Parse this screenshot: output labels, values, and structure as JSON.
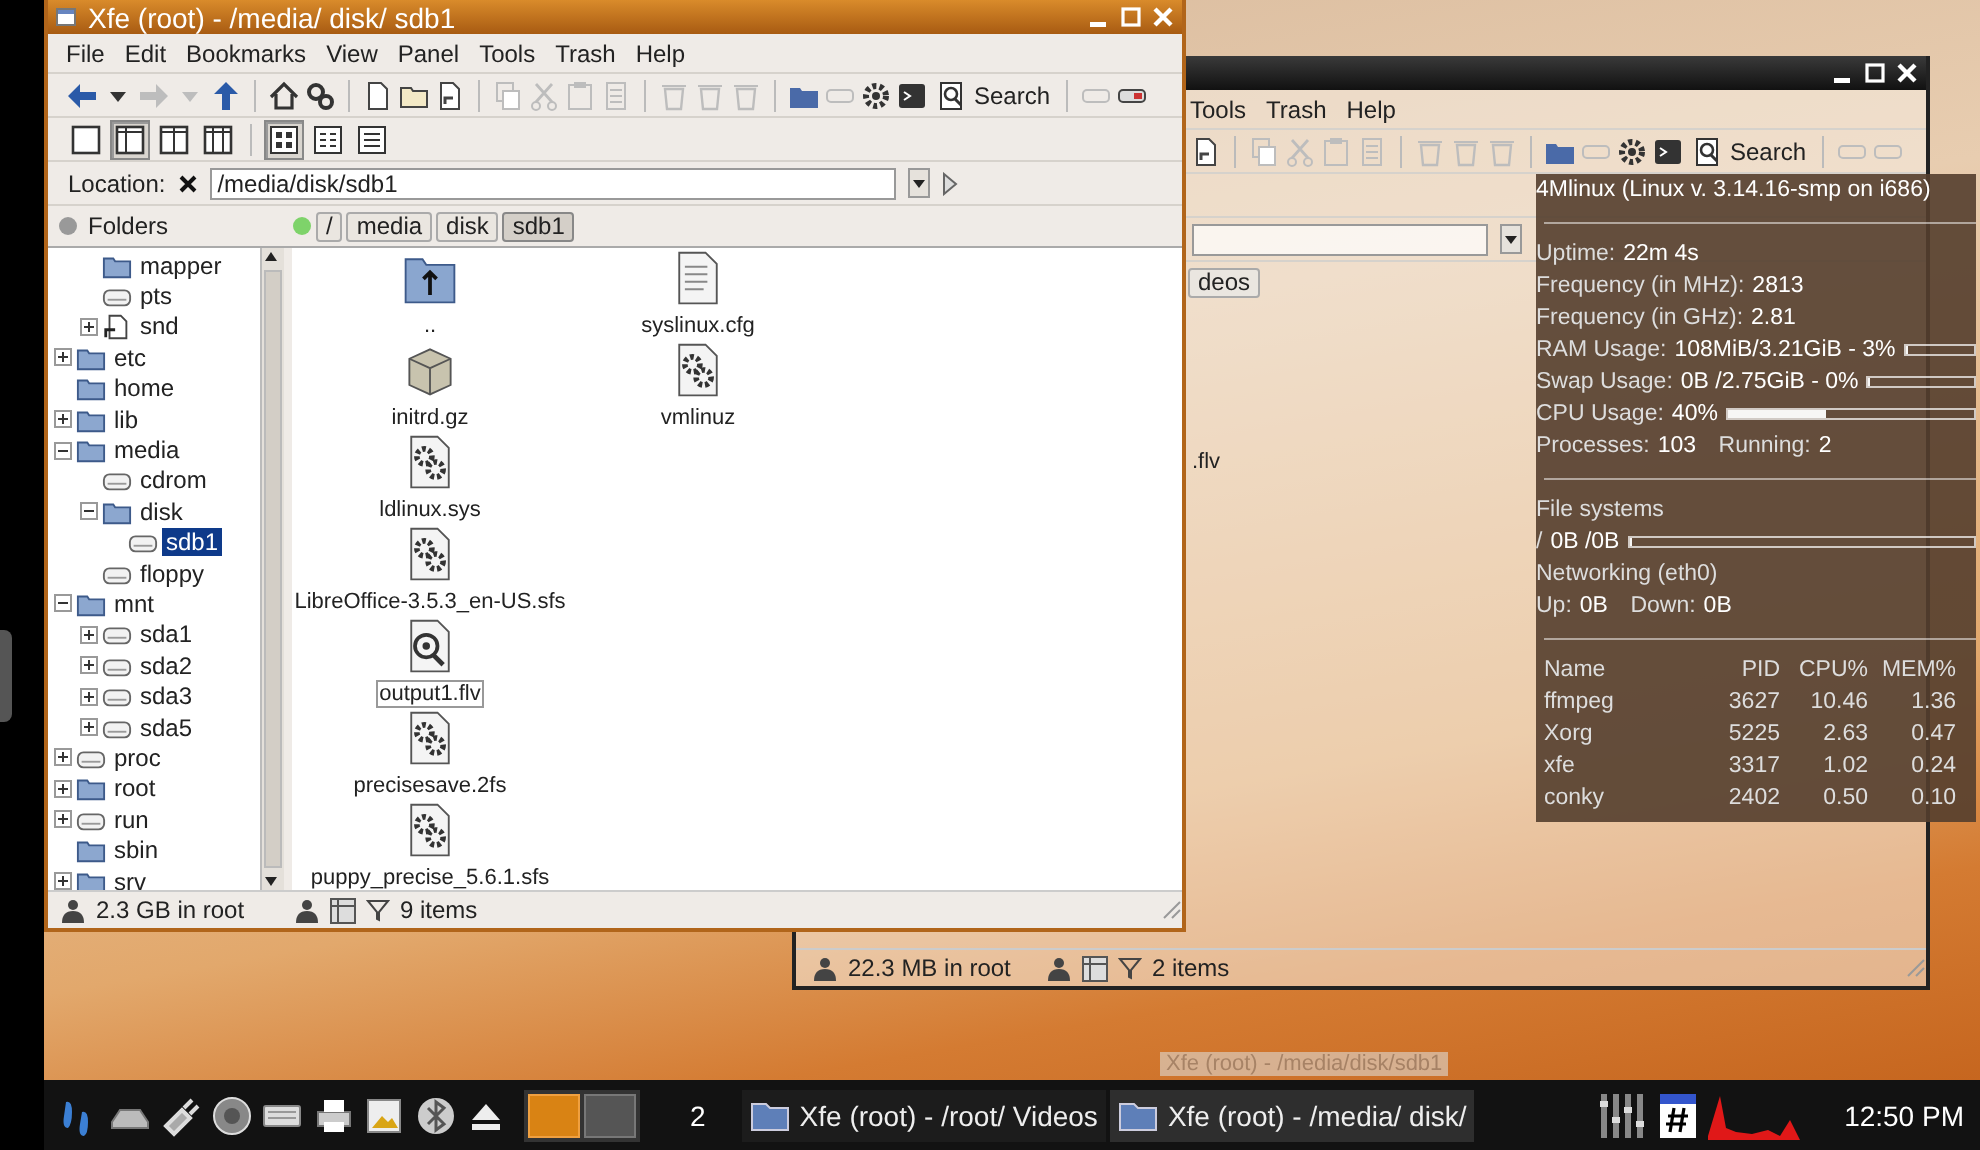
{
  "back_window": {
    "menu": [
      "Tools",
      "Trash",
      "Help"
    ],
    "toolbar": [
      {
        "kind": "link",
        "disabled": false
      },
      {
        "kind": "separator"
      },
      {
        "kind": "copy",
        "disabled": true
      },
      {
        "kind": "cut",
        "disabled": true
      },
      {
        "kind": "paste",
        "disabled": true
      },
      {
        "kind": "props",
        "disabled": true
      },
      {
        "kind": "separator"
      },
      {
        "kind": "trash",
        "disabled": true
      },
      {
        "kind": "trash",
        "disabled": true
      },
      {
        "kind": "trash",
        "disabled": true
      },
      {
        "kind": "separator"
      },
      {
        "kind": "dirs",
        "disabled": false
      },
      {
        "kind": "dirs2",
        "disabled": true
      },
      {
        "kind": "gears",
        "disabled": false
      },
      {
        "kind": "terminal",
        "disabled": false
      },
      {
        "kind": "search",
        "label": "Search",
        "disabled": false
      },
      {
        "kind": "separator"
      },
      {
        "kind": "panel",
        "disabled": true
      },
      {
        "kind": "panel",
        "disabled": true
      }
    ],
    "breadcrumb": [
      {
        "label": "deos",
        "selected": false
      }
    ],
    "files": [
      ".flv"
    ],
    "status": {
      "disk": "22.3 MB in root",
      "items": "2 items"
    }
  },
  "conky": {
    "lines": [
      {
        "kind": "title",
        "text": "4Mlinux (Linux v. 3.14.16-smp on i686)"
      },
      {
        "kind": "rule"
      },
      {
        "kind": "pair",
        "label": "Uptime:",
        "value": "22m 4s"
      },
      {
        "kind": "pair",
        "label": "Frequency (in MHz):",
        "value": "2813"
      },
      {
        "kind": "pair",
        "label": "Frequency (in GHz):",
        "value": "2.81"
      },
      {
        "kind": "bar",
        "label": "RAM Usage:",
        "value": "108MiB/3.21GiB - 3%",
        "level": 0.03
      },
      {
        "kind": "bar",
        "label": "Swap Usage:",
        "value": "0B /2.75GiB - 0%",
        "level": 0
      },
      {
        "kind": "bar",
        "label": "CPU Usage:",
        "value": "40%",
        "level": 0.4
      },
      {
        "kind": "pair",
        "label": "Processes:",
        "value": "103",
        "label2": "Running:",
        "value2": "2"
      },
      {
        "kind": "rule"
      },
      {
        "kind": "heading",
        "text": "File systems"
      },
      {
        "kind": "bar",
        "label": "/",
        "value": "0B /0B",
        "level": 0
      },
      {
        "kind": "heading",
        "text": "Networking (eth0)"
      },
      {
        "kind": "pair",
        "label": "Up:",
        "value": "0B",
        "label2": "Down:",
        "value2": "0B"
      },
      {
        "kind": "rule"
      }
    ],
    "table": {
      "columns": [
        "Name",
        "PID",
        "CPU%",
        "MEM%"
      ],
      "rows": [
        [
          "ffmpeg",
          "3627",
          "10.46",
          "1.36"
        ],
        [
          "Xorg",
          "5225",
          "2.63",
          "0.47"
        ],
        [
          "xfe",
          "3317",
          "1.02",
          "0.24"
        ],
        [
          "conky",
          "2402",
          "0.50",
          "0.10"
        ]
      ]
    }
  },
  "front_window": {
    "title": "Xfe (root) - /media/ disk/ sdb1",
    "menu": [
      "File",
      "Edit",
      "Bookmarks",
      "View",
      "Panel",
      "Tools",
      "Trash",
      "Help"
    ],
    "toolbar": [
      {
        "kind": "back",
        "disabled": false
      },
      {
        "kind": "caret",
        "disabled": false
      },
      {
        "kind": "forward",
        "disabled": true
      },
      {
        "kind": "caret",
        "disabled": true
      },
      {
        "kind": "up",
        "disabled": false
      },
      {
        "kind": "separator"
      },
      {
        "kind": "home",
        "disabled": false
      },
      {
        "kind": "refresh",
        "disabled": false
      },
      {
        "kind": "separator"
      },
      {
        "kind": "file",
        "disabled": false
      },
      {
        "kind": "folder",
        "disabled": false
      },
      {
        "kind": "link",
        "disabled": false
      },
      {
        "kind": "separator"
      },
      {
        "kind": "copy",
        "disabled": true
      },
      {
        "kind": "cut",
        "disabled": true
      },
      {
        "kind": "paste",
        "disabled": true
      },
      {
        "kind": "props",
        "disabled": true
      },
      {
        "kind": "separator"
      },
      {
        "kind": "trash",
        "disabled": true
      },
      {
        "kind": "trash",
        "disabled": true
      },
      {
        "kind": "trash",
        "disabled": true
      },
      {
        "kind": "separator"
      },
      {
        "kind": "dirs",
        "disabled": false
      },
      {
        "kind": "dirs2",
        "disabled": true
      },
      {
        "kind": "gears",
        "disabled": false
      },
      {
        "kind": "terminal",
        "disabled": false
      },
      {
        "kind": "search",
        "label": "Search",
        "disabled": false
      },
      {
        "kind": "separator"
      },
      {
        "kind": "panel",
        "disabled": true
      },
      {
        "kind": "panel2",
        "disabled": false
      }
    ],
    "view_toolbar": [
      {
        "kind": "l1",
        "selected": false
      },
      {
        "kind": "l2",
        "selected": true
      },
      {
        "kind": "l3",
        "selected": false
      },
      {
        "kind": "l4",
        "selected": false
      },
      {
        "kind": "separator"
      },
      {
        "kind": "big",
        "selected": true
      },
      {
        "kind": "small",
        "selected": false
      },
      {
        "kind": "detail",
        "selected": false
      }
    ],
    "location": {
      "label": "Location:",
      "value": "/media/disk/sdb1"
    },
    "folders_label": "Folders",
    "breadcrumb": [
      {
        "label": "/",
        "selected": false
      },
      {
        "label": "media",
        "selected": false
      },
      {
        "label": "disk",
        "selected": false
      },
      {
        "label": "sdb1",
        "selected": true
      }
    ],
    "tree": {
      "scrolled_children": [
        {
          "label": "mapper",
          "kind": "folder",
          "selected": false
        },
        {
          "label": "pts",
          "kind": "drive",
          "selected": false
        },
        {
          "label": "snd",
          "kind": "link",
          "expanded": false,
          "selected": false
        }
      ],
      "items": [
        {
          "label": "etc",
          "kind": "folder",
          "expanded": false,
          "selected": false
        },
        {
          "label": "home",
          "kind": "folder",
          "selected": false
        },
        {
          "label": "lib",
          "kind": "folder",
          "expanded": false,
          "selected": false
        },
        {
          "label": "media",
          "kind": "folder",
          "expanded": true,
          "selected": false,
          "children": [
            {
              "label": "cdrom",
              "kind": "drive",
              "selected": false
            },
            {
              "label": "disk",
              "kind": "folder",
              "expanded": true,
              "selected": false,
              "children": [
                {
                  "label": "sdb1",
                  "kind": "drive",
                  "selected": true
                }
              ]
            },
            {
              "label": "floppy",
              "kind": "drive",
              "selected": false
            }
          ]
        },
        {
          "label": "mnt",
          "kind": "folder",
          "expanded": true,
          "selected": false,
          "children": [
            {
              "label": "sda1",
              "kind": "drive",
              "expanded": false,
              "selected": false
            },
            {
              "label": "sda2",
              "kind": "drive",
              "expanded": false,
              "selected": false
            },
            {
              "label": "sda3",
              "kind": "drive",
              "expanded": false,
              "selected": false
            },
            {
              "label": "sda5",
              "kind": "drive",
              "expanded": false,
              "selected": false
            }
          ]
        },
        {
          "label": "proc",
          "kind": "drive",
          "expanded": false,
          "selected": false
        },
        {
          "label": "root",
          "kind": "folder",
          "expanded": false,
          "selected": false
        },
        {
          "label": "run",
          "kind": "drive",
          "expanded": false,
          "selected": false
        },
        {
          "label": "sbin",
          "kind": "folder",
          "selected": false
        },
        {
          "label": "srv",
          "kind": "folder",
          "expanded": false,
          "selected": false
        }
      ]
    },
    "files": [
      {
        "name": "..",
        "kind": "parent",
        "focused": false
      },
      {
        "name": "initrd.gz",
        "kind": "archive",
        "focused": false
      },
      {
        "name": "ldlinux.sys",
        "kind": "exec",
        "focused": false
      },
      {
        "name": "LibreOffice-3.5.3_en-US.sfs",
        "kind": "exec",
        "focused": false
      },
      {
        "name": "output1.flv",
        "kind": "video",
        "focused": true
      },
      {
        "name": "precisesave.2fs",
        "kind": "exec",
        "focused": false
      },
      {
        "name": "puppy_precise_5.6.1.sfs",
        "kind": "exec",
        "focused": false
      },
      {
        "name": "syslinux.cfg",
        "kind": "text",
        "focused": false
      },
      {
        "name": "vmlinuz",
        "kind": "exec",
        "focused": false
      }
    ],
    "status": {
      "disk": "2.3 GB in root",
      "items": "9 items"
    }
  },
  "taskbar": {
    "pager": [
      {
        "selected": true
      },
      {
        "selected": false
      }
    ],
    "desktop_count": "2",
    "tasks": [
      {
        "label": "Xfe (root) - /root/ Videos",
        "selected": false
      },
      {
        "label": "Xfe (root) - /media/ disk/",
        "selected": true
      }
    ],
    "tooltip": "Xfe (root) - /media/disk/sdb1",
    "clock": "12:50 PM"
  }
}
